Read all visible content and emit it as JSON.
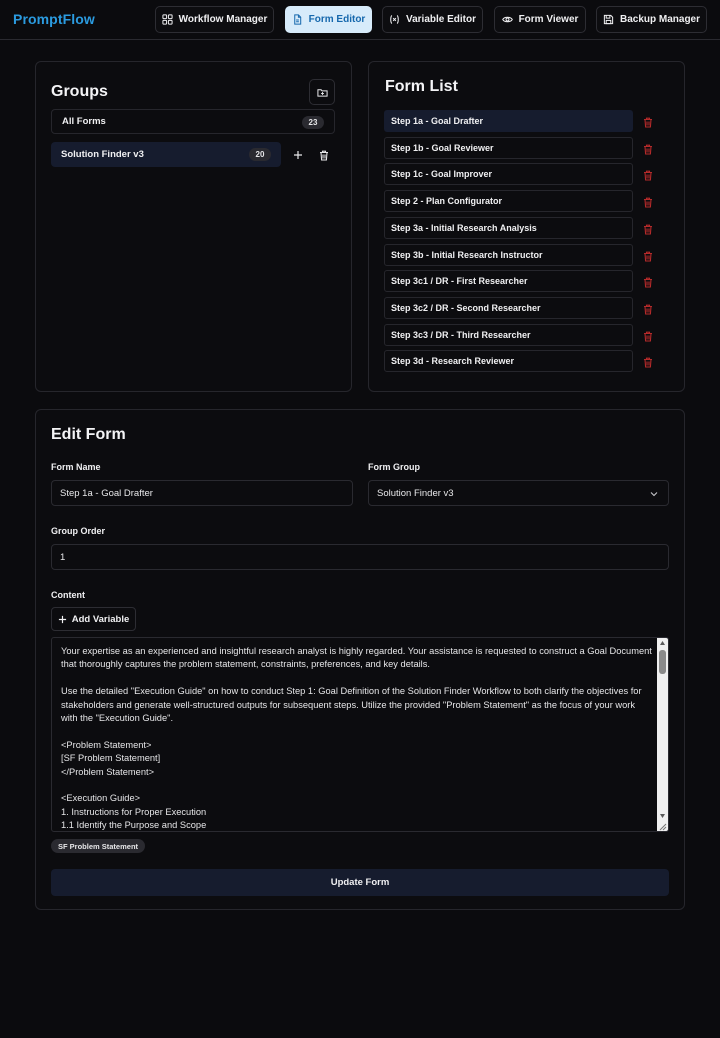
{
  "app": {
    "brand": "PromptFlow"
  },
  "nav": [
    {
      "label": "Workflow Manager",
      "icon": "grid-icon",
      "active": false
    },
    {
      "label": "Form Editor",
      "icon": "document-icon",
      "active": true
    },
    {
      "label": "Variable Editor",
      "icon": "variable-icon",
      "active": false
    },
    {
      "label": "Form Viewer",
      "icon": "eye-icon",
      "active": false
    },
    {
      "label": "Backup Manager",
      "icon": "save-icon",
      "active": false
    }
  ],
  "groups": {
    "title": "Groups",
    "items": [
      {
        "label": "All Forms",
        "count": "23"
      },
      {
        "label": "Solution Finder v3",
        "count": "20"
      }
    ]
  },
  "form_list": {
    "title": "Form List",
    "items": [
      "Step 1a - Goal Drafter",
      "Step 1b - Goal Reviewer",
      "Step 1c - Goal Improver",
      "Step 2 - Plan Configurator",
      "Step 3a - Initial Research Analysis",
      "Step 3b - Initial Research Instructor",
      "Step 3c1 / DR - First Researcher",
      "Step 3c2 / DR - Second Researcher",
      "Step 3c3 / DR - Third Researcher",
      "Step 3d - Research Reviewer"
    ]
  },
  "edit_form": {
    "title": "Edit Form",
    "form_name_label": "Form Name",
    "form_name_value": "Step 1a - Goal Drafter",
    "form_group_label": "Form Group",
    "form_group_value": "Solution Finder v3",
    "group_order_label": "Group Order",
    "group_order_value": "1",
    "content_label": "Content",
    "add_variable_label": "Add Variable",
    "content_text": "Your expertise as an experienced and insightful research analyst is highly regarded. Your assistance is requested to construct a Goal Document that thoroughly captures the problem statement, constraints, preferences, and key details.\n\nUse the detailed \"Execution Guide\" on how to conduct Step 1: Goal Definition of the Solution Finder Workflow to both clarify the objectives for stakeholders and generate well-structured outputs for subsequent steps. Utilize the provided \"Problem Statement\" as the focus of your work with the \"Execution Guide\".\n\n<Problem Statement>\n[SF Problem Statement]\n</Problem Statement>\n\n<Execution Guide>\n1. Instructions for Proper Execution\n1.1 Identify the Purpose and Scope",
    "variable_chip": "SF Problem Statement",
    "update_button": "Update Form"
  },
  "colors": {
    "brand": "#2b9be0",
    "active_nav_bg": "#d7ebfa",
    "selected_bg": "#161c2e",
    "delete": "#b52a2a"
  }
}
